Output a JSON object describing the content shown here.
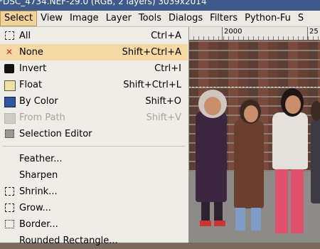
{
  "window": {
    "title": "*DSC_4734.NEF-29.0 (RGB, 2 layers) 3039x2014"
  },
  "menubar": {
    "items": [
      {
        "label": "Select",
        "active": true
      },
      {
        "label": "View"
      },
      {
        "label": "Image"
      },
      {
        "label": "Layer"
      },
      {
        "label": "Tools"
      },
      {
        "label": "Dialogs"
      },
      {
        "label": "Filters"
      },
      {
        "label": "Python-Fu"
      },
      {
        "label": "S"
      }
    ]
  },
  "ruler": {
    "labels": [
      "2000",
      "25"
    ]
  },
  "select_menu": {
    "items": [
      {
        "label": "All",
        "shortcut": "Ctrl+A",
        "icon": "select-all-icon"
      },
      {
        "label": "None",
        "shortcut": "Shift+Ctrl+A",
        "icon": "select-none-icon",
        "highlighted": true
      },
      {
        "label": "Invert",
        "shortcut": "Ctrl+I",
        "icon": "invert-icon"
      },
      {
        "label": "Float",
        "shortcut": "Shift+Ctrl+L",
        "icon": "float-icon"
      },
      {
        "label": "By Color",
        "shortcut": "Shift+O",
        "icon": "by-color-icon"
      },
      {
        "label": "From Path",
        "shortcut": "Shift+V",
        "icon": "from-path-icon",
        "disabled": true
      },
      {
        "label": "Selection Editor",
        "shortcut": "",
        "icon": "selection-editor-icon"
      },
      {
        "label": "Feather...",
        "shortcut": "",
        "icon": ""
      },
      {
        "label": "Sharpen",
        "shortcut": "",
        "icon": ""
      },
      {
        "label": "Shrink...",
        "shortcut": "",
        "icon": "shrink-icon"
      },
      {
        "label": "Grow...",
        "shortcut": "",
        "icon": "grow-icon"
      },
      {
        "label": "Border...",
        "shortcut": "",
        "icon": "border-icon"
      },
      {
        "label": "Rounded Rectangle...",
        "shortcut": "",
        "icon": ""
      }
    ]
  },
  "colors": {
    "highlight": "#f4d9a3",
    "menu_bg": "#efede8",
    "title_bg": "#3d5a8a"
  }
}
